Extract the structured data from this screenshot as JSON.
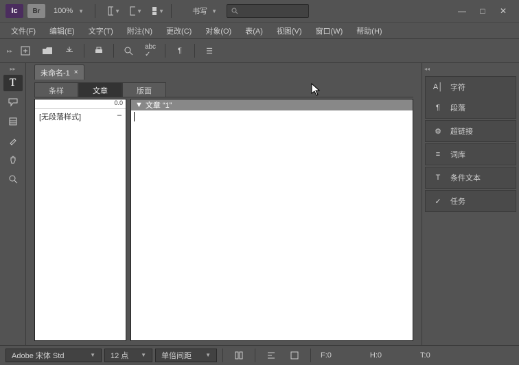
{
  "titlebar": {
    "logo": "Ic",
    "br": "Br",
    "zoom": "100%",
    "workspace": "书写",
    "search_placeholder": ""
  },
  "menu": [
    "文件(F)",
    "编辑(E)",
    "文字(T)",
    "附注(N)",
    "更改(C)",
    "对象(O)",
    "表(A)",
    "视图(V)",
    "窗口(W)",
    "帮助(H)"
  ],
  "doc_tab": {
    "label": "未命名-1",
    "close": "×"
  },
  "view_tabs": [
    "条样",
    "文章",
    "版面"
  ],
  "styles_panel": {
    "header": "0.0",
    "rows": [
      {
        "name": "[无段落样式]",
        "mark": "–"
      }
    ]
  },
  "article": {
    "header_triangle": "▼",
    "header": "文章 “1”"
  },
  "right_panels": {
    "group1": [
      {
        "icon": "A│",
        "label": "字符"
      },
      {
        "icon": "¶",
        "label": "段落"
      }
    ],
    "group2": [
      {
        "icon": "⚙",
        "label": "超链接"
      }
    ],
    "group3": [
      {
        "icon": "≡",
        "label": "词库"
      }
    ],
    "group4": [
      {
        "icon": "T",
        "label": "条件文本"
      }
    ],
    "group5": [
      {
        "icon": "✓",
        "label": "任务"
      }
    ]
  },
  "status": {
    "font": "Adobe 宋体 Std",
    "size": "12 点",
    "spacing": "单倍间距",
    "f": "F:0",
    "h": "H:0",
    "t": "T:0"
  }
}
